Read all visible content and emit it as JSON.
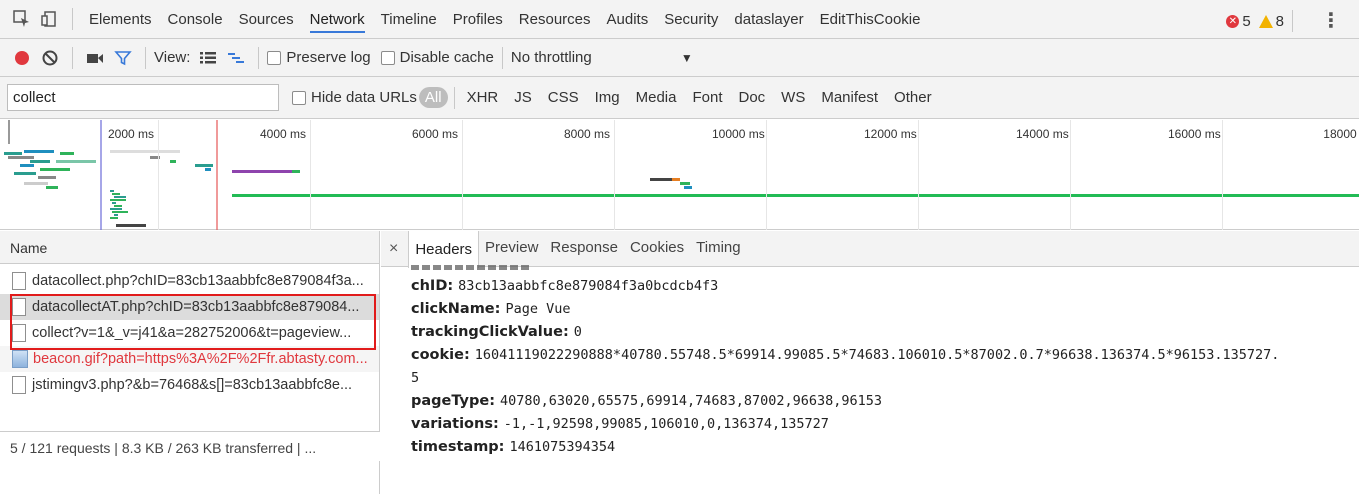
{
  "devtools_tabs": [
    "Elements",
    "Console",
    "Sources",
    "Network",
    "Timeline",
    "Profiles",
    "Resources",
    "Audits",
    "Security",
    "dataslayer",
    "EditThisCookie"
  ],
  "active_tab": "Network",
  "counts": {
    "errors": "5",
    "warnings": "8"
  },
  "toolbar": {
    "view_label": "View:",
    "preserve_log": "Preserve log",
    "disable_cache": "Disable cache",
    "throttling": "No throttling"
  },
  "filter": {
    "search_value": "collect",
    "hide_data_urls": "Hide data URLs",
    "all": "All",
    "types": [
      "XHR",
      "JS",
      "CSS",
      "Img",
      "Media",
      "Font",
      "Doc",
      "WS",
      "Manifest",
      "Other"
    ]
  },
  "overview": {
    "ticks": [
      "2000 ms",
      "4000 ms",
      "6000 ms",
      "8000 ms",
      "10000 ms",
      "12000 ms",
      "14000 ms",
      "16000 ms",
      "18000 m"
    ]
  },
  "requests": {
    "header": "Name",
    "rows": [
      {
        "name": "datacollect.php?chID=83cb13aabbfc8e879084f3a...",
        "kind": "doc"
      },
      {
        "name": "datacollectAT.php?chID=83cb13aabbfc8e879084...",
        "kind": "doc"
      },
      {
        "name": "collect?v=1&_v=j41&a=282752006&t=pageview...",
        "kind": "doc"
      },
      {
        "name": "beacon.gif?path=https%3A%2F%2Ffr.abtasty.com...",
        "kind": "img"
      },
      {
        "name": "jstimingv3.php?&b=76468&s[]=83cb13aabbfc8e...",
        "kind": "doc"
      }
    ],
    "status": "5 / 121 requests | 8.3 KB / 263 KB transferred | ..."
  },
  "detail": {
    "close": "×",
    "tabs": [
      "Headers",
      "Preview",
      "Response",
      "Cookies",
      "Timing"
    ],
    "active_tab": "Headers",
    "params": [
      {
        "key": "chID:",
        "value": "83cb13aabbfc8e879084f3a0bcdcb4f3"
      },
      {
        "key": "clickName:",
        "value": "Page Vue"
      },
      {
        "key": "trackingClickValue:",
        "value": "0"
      },
      {
        "key": "cookie:",
        "value": "16041119022290888*40780.55748.5*69914.99085.5*74683.106010.5*87002.0.7*96638.136374.5*96153.135727."
      },
      {
        "key": "",
        "value": "5"
      },
      {
        "key": "pageType:",
        "value": "40780,63020,65575,69914,74683,87002,96638,96153"
      },
      {
        "key": "variations:",
        "value": "-1,-1,92598,99085,106010,0,136374,135727"
      },
      {
        "key": "timestamp:",
        "value": "1461075394354"
      }
    ]
  },
  "colors": {
    "accent": "#3879d9",
    "record": "#e0383e",
    "error_text": "#e0383e",
    "highlight": "#e11b1b",
    "filter_icon": "#3879d9"
  }
}
